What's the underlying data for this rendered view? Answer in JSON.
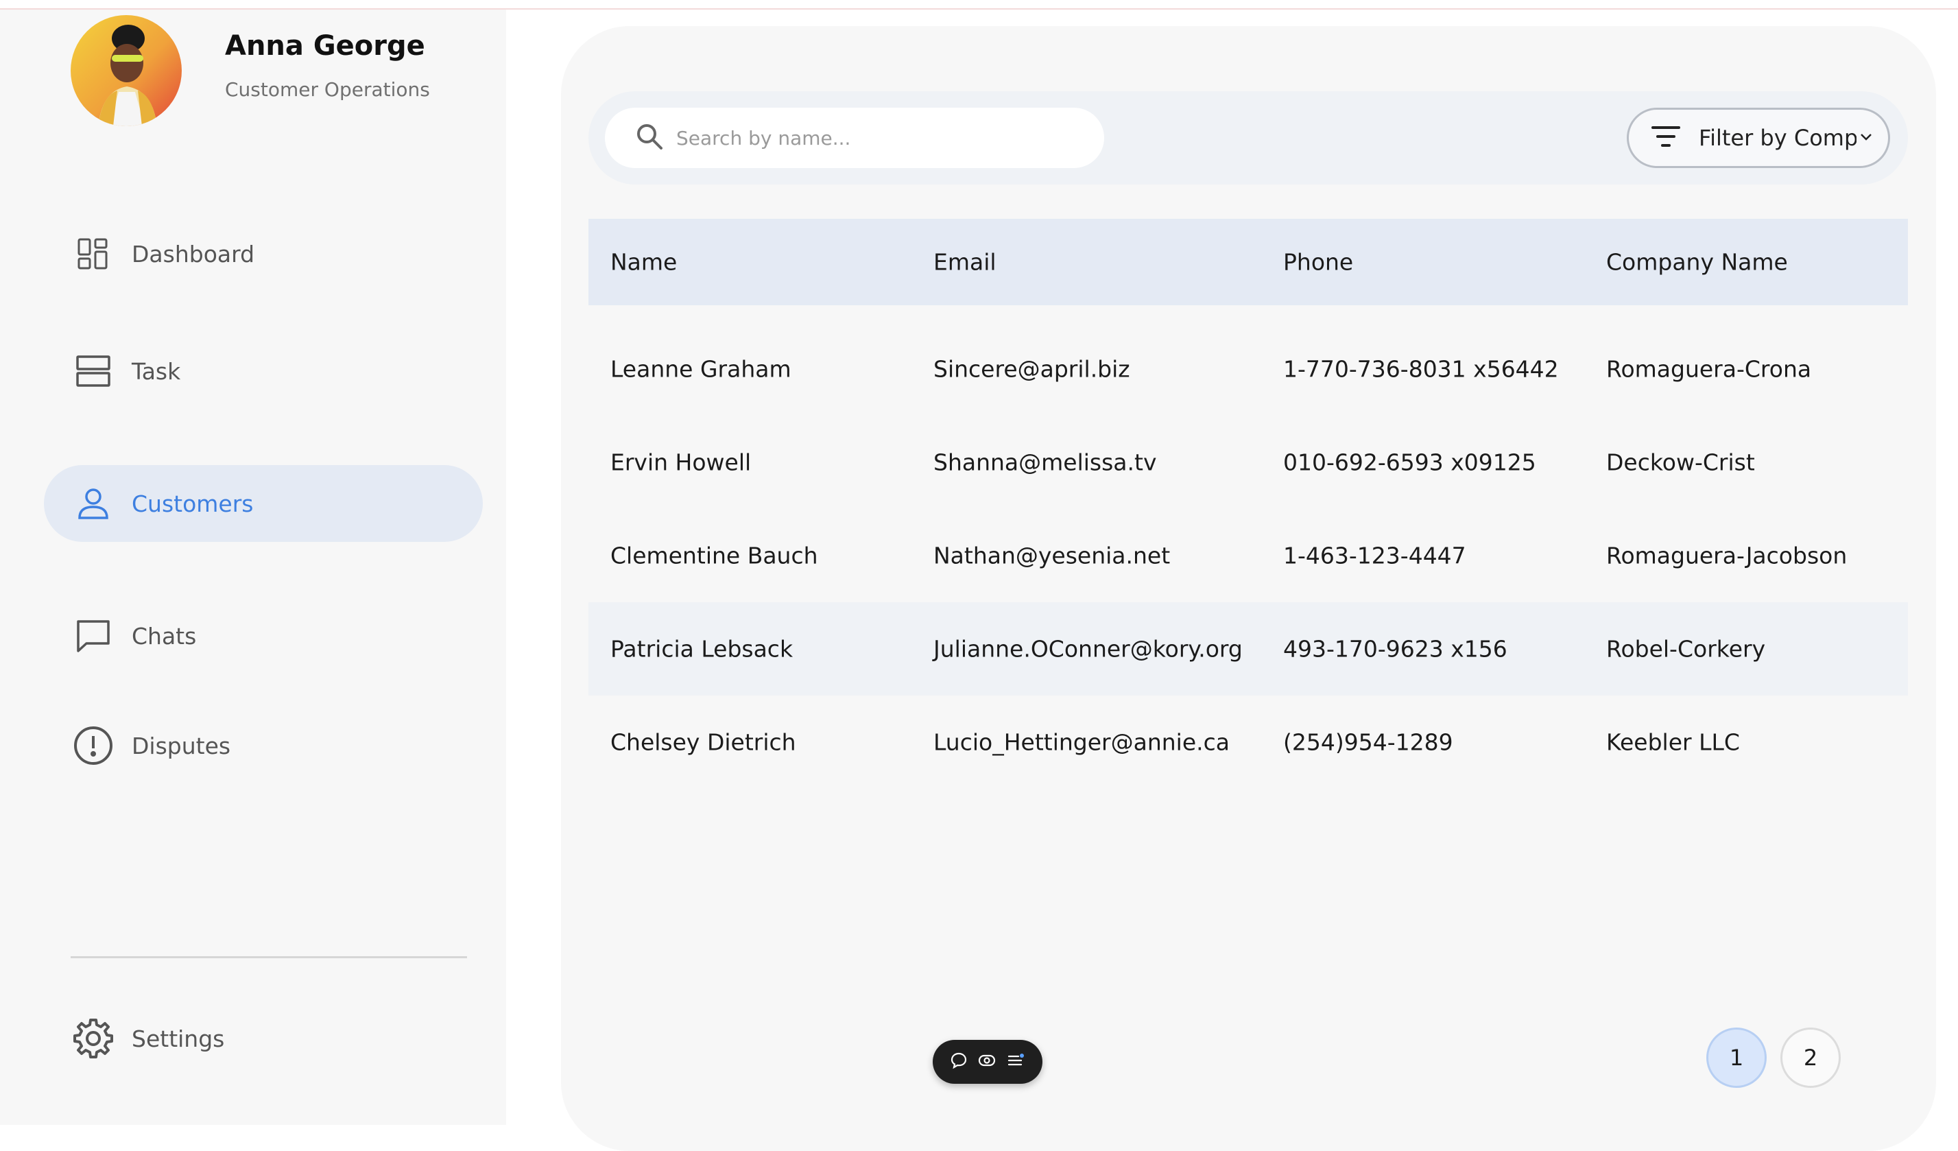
{
  "user": {
    "name": "Anna George",
    "role": "Customer Operations"
  },
  "sidebar": {
    "items": [
      {
        "label": "Dashboard",
        "icon": "dashboard-icon",
        "active": false
      },
      {
        "label": "Task",
        "icon": "task-icon",
        "active": false
      },
      {
        "label": "Customers",
        "icon": "user-icon",
        "active": true
      },
      {
        "label": "Chats",
        "icon": "chat-icon",
        "active": false
      },
      {
        "label": "Disputes",
        "icon": "alert-circle-icon",
        "active": false
      }
    ],
    "settings_label": "Settings"
  },
  "search": {
    "placeholder": "Search by name..."
  },
  "filter": {
    "label": "Filter by Comp"
  },
  "table": {
    "headers": [
      "Name",
      "Email",
      "Phone",
      "Company Name"
    ],
    "rows": [
      [
        "Leanne Graham",
        "Sincere@april.biz",
        "1-770-736-8031 x56442",
        "Romaguera-Crona"
      ],
      [
        "Ervin Howell",
        "Shanna@melissa.tv",
        "010-692-6593 x09125",
        "Deckow-Crist"
      ],
      [
        "Clementine Bauch",
        "Nathan@yesenia.net",
        "1-463-123-4447",
        "Romaguera-Jacobson"
      ],
      [
        "Patricia Lebsack",
        "Julianne.OConner@kory.org",
        "493-170-9623 x156",
        "Robel-Corkery"
      ],
      [
        "Chelsey Dietrich",
        "Lucio_Hettinger@annie.ca",
        "(254)954-1289",
        "Keebler LLC"
      ]
    ]
  },
  "pagination": {
    "pages": [
      "1",
      "2"
    ],
    "current": "1"
  },
  "colors": {
    "accent": "#3d7fe0",
    "active_bg": "#e4eaf4"
  }
}
